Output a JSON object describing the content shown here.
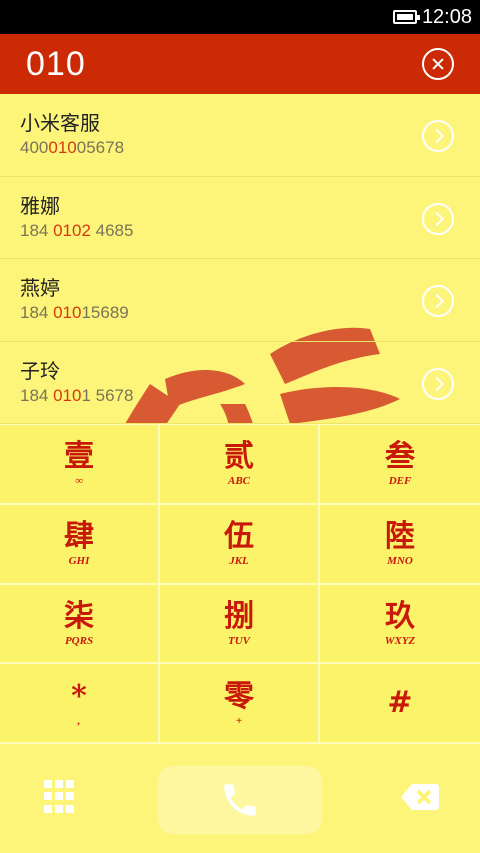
{
  "status_bar": {
    "time": "12:08"
  },
  "header": {
    "number": "010"
  },
  "contacts": [
    {
      "name": "小米客服",
      "phone_pre": "400",
      "phone_hl": "010",
      "phone_post": "05678"
    },
    {
      "name": "雅娜",
      "phone_pre": "184 ",
      "phone_hl": "0102",
      "phone_post": " 4685"
    },
    {
      "name": "燕婷",
      "phone_pre": "184 ",
      "phone_hl": "010",
      "phone_post": "15689"
    },
    {
      "name": "子玲",
      "phone_pre": "184 ",
      "phone_hl": "010",
      "phone_post": "1 5678"
    }
  ],
  "keypad": [
    {
      "digit": "壹",
      "letters": "∞"
    },
    {
      "digit": "贰",
      "letters": "ABC"
    },
    {
      "digit": "叁",
      "letters": "DEF"
    },
    {
      "digit": "肆",
      "letters": "GHI"
    },
    {
      "digit": "伍",
      "letters": "JKL"
    },
    {
      "digit": "陸",
      "letters": "MNO"
    },
    {
      "digit": "柒",
      "letters": "PQRS"
    },
    {
      "digit": "捌",
      "letters": "TUV"
    },
    {
      "digit": "玖",
      "letters": "WXYZ"
    },
    {
      "digit": "*",
      "letters": ","
    },
    {
      "digit": "零",
      "letters": "+"
    },
    {
      "digit": "#",
      "letters": ""
    }
  ],
  "colors": {
    "header_bg": "#cc2a05",
    "list_bg": "#fdf57a",
    "highlight": "#d53a0c",
    "key_text": "#c8180b"
  },
  "icons": {
    "close": "close-circle-icon",
    "arrow": "chevron-right-circle-icon",
    "dialpad": "dialpad-icon",
    "call": "phone-icon",
    "backspace": "backspace-icon"
  }
}
